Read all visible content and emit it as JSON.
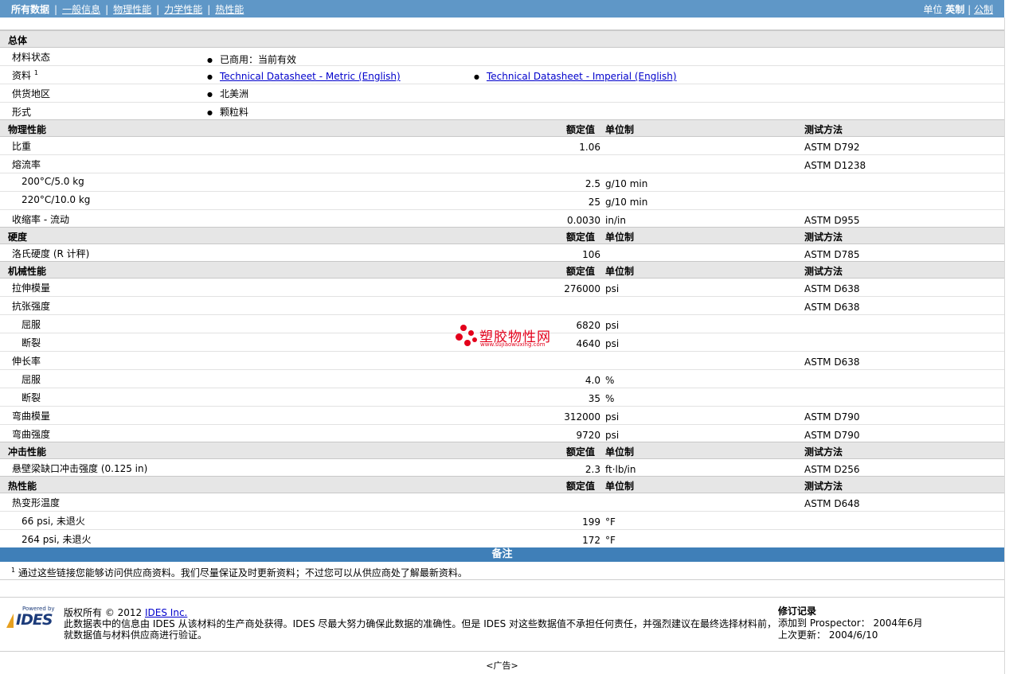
{
  "nav": {
    "items": [
      "所有数据",
      "一般信息",
      "物理性能",
      "力学性能",
      "热性能"
    ],
    "units_label": "单位",
    "unit_selected": "英制",
    "unit_other": "公制"
  },
  "general": {
    "title": "总体",
    "status_label": "材料状态",
    "status_value": "已商用：当前有效",
    "docs_label": "资料",
    "docs_sup": "1",
    "doc_metric": "Technical Datasheet - Metric (English)",
    "doc_imperial": "Technical Datasheet - Imperial (English)",
    "region_label": "供货地区",
    "region_value": "北美洲",
    "form_label": "形式",
    "form_value": "颗粒料"
  },
  "headers": {
    "value": "额定值",
    "unit": "单位制",
    "method": "测试方法"
  },
  "physical": {
    "title": "物理性能",
    "rows": [
      {
        "name": "比重",
        "value": "1.06",
        "unit": "",
        "method": "ASTM D792"
      },
      {
        "name": "熔流率",
        "value": "",
        "unit": "",
        "method": "ASTM D1238"
      },
      {
        "name": "200°C/5.0 kg",
        "value": "2.5",
        "unit": "g/10 min",
        "method": ""
      },
      {
        "name": "220°C/10.0 kg",
        "value": "25",
        "unit": "g/10 min",
        "method": ""
      },
      {
        "name": "收缩率 - 流动",
        "value": "0.0030",
        "unit": "in/in",
        "method": "ASTM D955"
      }
    ]
  },
  "hardness": {
    "title": "硬度",
    "rows": [
      {
        "name": "洛氏硬度 (R 计秤)",
        "value": "106",
        "unit": "",
        "method": "ASTM D785"
      }
    ]
  },
  "mechanical": {
    "title": "机械性能",
    "rows": [
      {
        "name": "拉伸模量",
        "value": "276000",
        "unit": "psi",
        "method": "ASTM D638"
      },
      {
        "name": "抗张强度",
        "value": "",
        "unit": "",
        "method": "ASTM D638"
      },
      {
        "name": "屈服",
        "value": "6820",
        "unit": "psi",
        "method": ""
      },
      {
        "name": "断裂",
        "value": "4640",
        "unit": "psi",
        "method": ""
      },
      {
        "name": "伸长率",
        "value": "",
        "unit": "",
        "method": "ASTM D638"
      },
      {
        "name": "屈服",
        "value": "4.0",
        "unit": "%",
        "method": ""
      },
      {
        "name": "断裂",
        "value": "35",
        "unit": "%",
        "method": ""
      },
      {
        "name": "弯曲模量",
        "value": "312000",
        "unit": "psi",
        "method": "ASTM D790"
      },
      {
        "name": "弯曲强度",
        "value": "9720",
        "unit": "psi",
        "method": "ASTM D790"
      }
    ]
  },
  "impact": {
    "title": "冲击性能",
    "rows": [
      {
        "name": "悬壁梁缺口冲击强度 (0.125 in)",
        "value": "2.3",
        "unit": "ft·lb/in",
        "method": "ASTM D256"
      }
    ]
  },
  "thermal": {
    "title": "热性能",
    "rows": [
      {
        "name": "热变形温度",
        "value": "",
        "unit": "",
        "method": "ASTM D648"
      },
      {
        "name": "66 psi, 未退火",
        "value": "199",
        "unit": "°F",
        "method": ""
      },
      {
        "name": "264 psi, 未退火",
        "value": "172",
        "unit": "°F",
        "method": ""
      }
    ]
  },
  "notes": {
    "title": "备注",
    "sup": "1",
    "text": "通过这些链接您能够访问供应商资料。我们尽量保证及时更新资料；不过您可以从供应商处了解最新资料。"
  },
  "footer": {
    "logo_powered": "Powered by",
    "logo_name": "IDES",
    "copyright_prefix": "版权所有 © 2012",
    "copyright_link": "IDES Inc.",
    "disclaimer_1": "此数据表中的信息由 IDES 从该材料的生产商处获得。IDES 尽最大努力确保此数据的准确性。但是 IDES 对这些数据值不承担任何责任，并强烈建议在最终选择材料前，",
    "disclaimer_2": "就数据值与材料供应商进行验证。",
    "revision_title": "修订记录",
    "added": "添加到 Prospector： 2004年6月",
    "updated": "上次更新： 2004/6/10"
  },
  "ad": "<广告>",
  "watermark": {
    "cn": "塑胶物性网",
    "en": "www.sujiaowuxing.com"
  }
}
